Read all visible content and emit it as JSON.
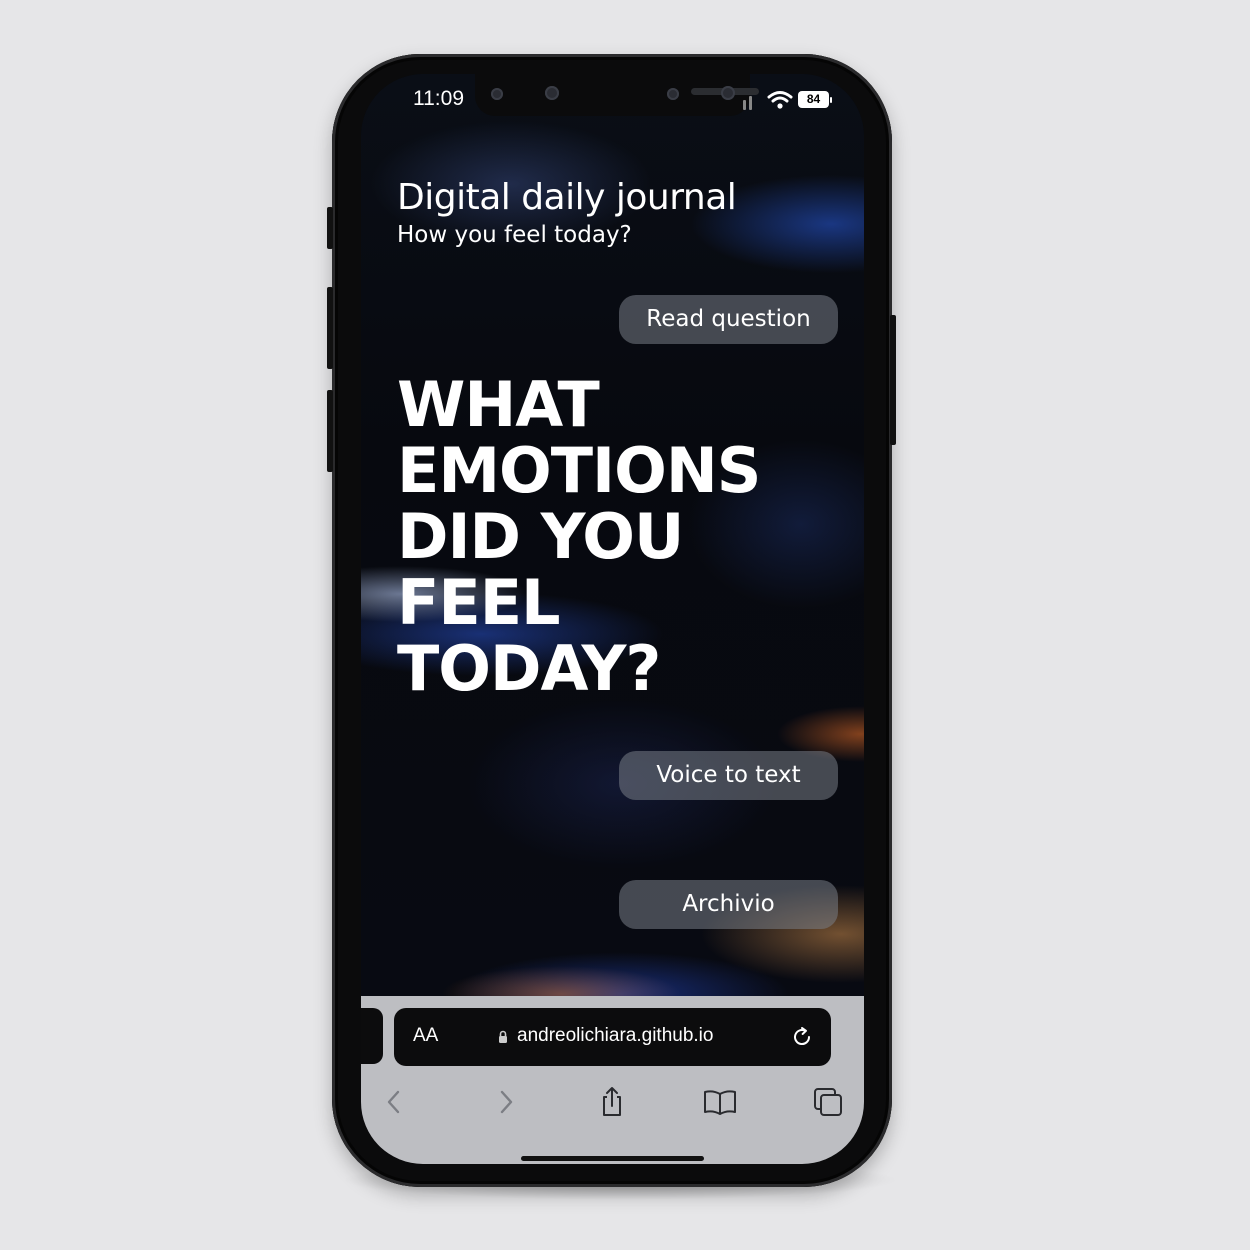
{
  "status_bar": {
    "time": "11:09",
    "battery": "84"
  },
  "header": {
    "title": "Digital daily journal",
    "subtitle": "How you feel today?"
  },
  "buttons": {
    "read_question": "Read question",
    "voice_to_text": "Voice to text",
    "archive": "Archivio"
  },
  "question_lines": [
    "WHAT",
    "EMOTIONS",
    "DID YOU",
    "FEEL",
    "TODAY?"
  ],
  "browser": {
    "text_size_label": "AA",
    "url": "andreolichiara.github.io"
  },
  "icons": {
    "back": "chevron-left-icon",
    "forward": "chevron-right-icon",
    "share": "share-icon",
    "bookmarks": "book-icon",
    "tabs": "tabs-icon",
    "reload": "reload-icon",
    "lock": "lock-icon",
    "wifi": "wifi-icon",
    "signal": "signal-icon"
  },
  "colors": {
    "page_background": "#e6e6e8",
    "phone_body": "#0b0b0c",
    "button_fill": "#787d87",
    "browser_bar": "#bdbec2",
    "url_bar": "#0c0c0d"
  }
}
